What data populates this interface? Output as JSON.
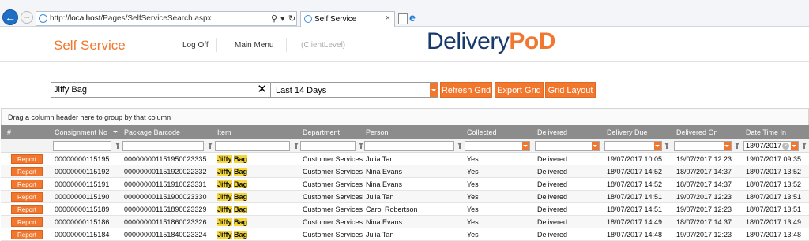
{
  "browser": {
    "url_prefix": "http://",
    "url_host": "localhost",
    "url_path": "/Pages/SelfServiceSearch.aspx",
    "tab_title": "Self Service"
  },
  "header": {
    "app_title": "Self Service",
    "nav": [
      "Log Off",
      "Main Menu",
      "(ClientLevel)"
    ],
    "logo_part1": "Delivery",
    "logo_part2": "PoD"
  },
  "toolbar": {
    "search_value": "Jiffy Bag",
    "period": "Last 14 Days",
    "buttons": [
      "Refresh Grid",
      "Export Grid",
      "Grid Layout"
    ]
  },
  "grid": {
    "group_hint": "Drag a column header here to group by that column",
    "columns": [
      "#",
      "Consignment No",
      "Package Barcode",
      "Item",
      "Department",
      "Person",
      "Collected",
      "Delivered",
      "Delivery Due",
      "Delivered On",
      "Date Time In"
    ],
    "date_filter": "13/07/2017",
    "report_label": "Report",
    "highlight": [
      "Jiffy",
      "Bag"
    ],
    "rows": [
      {
        "consignment": "00000000115195",
        "barcode": "000000001151950023335",
        "department": "Customer Services",
        "person": "Julia Tan",
        "collected": "Yes",
        "delivered": "Delivered",
        "due": "19/07/2017 10:05",
        "delivered_on": "19/07/2017 12:23",
        "time_in": "19/07/2017 09:35"
      },
      {
        "consignment": "00000000115192",
        "barcode": "000000001151920022332",
        "department": "Customer Services",
        "person": "Nina Evans",
        "collected": "Yes",
        "delivered": "Delivered",
        "due": "18/07/2017 14:52",
        "delivered_on": "18/07/2017 14:37",
        "time_in": "18/07/2017 13:52"
      },
      {
        "consignment": "00000000115191",
        "barcode": "000000001151910023331",
        "department": "Customer Services",
        "person": "Nina Evans",
        "collected": "Yes",
        "delivered": "Delivered",
        "due": "18/07/2017 14:52",
        "delivered_on": "18/07/2017 14:37",
        "time_in": "18/07/2017 13:52"
      },
      {
        "consignment": "00000000115190",
        "barcode": "000000001151900023330",
        "department": "Customer Services",
        "person": "Julia Tan",
        "collected": "Yes",
        "delivered": "Delivered",
        "due": "18/07/2017 14:51",
        "delivered_on": "19/07/2017 12:23",
        "time_in": "18/07/2017 13:51"
      },
      {
        "consignment": "00000000115189",
        "barcode": "000000001151890023329",
        "department": "Customer Services",
        "person": "Carol Robertson",
        "collected": "Yes",
        "delivered": "Delivered",
        "due": "18/07/2017 14:51",
        "delivered_on": "19/07/2017 12:23",
        "time_in": "18/07/2017 13:51"
      },
      {
        "consignment": "00000000115186",
        "barcode": "000000001151860023326",
        "department": "Customer Services",
        "person": "Nina Evans",
        "collected": "Yes",
        "delivered": "Delivered",
        "due": "18/07/2017 14:49",
        "delivered_on": "18/07/2017 14:37",
        "time_in": "18/07/2017 13:49"
      },
      {
        "consignment": "00000000115184",
        "barcode": "000000001151840023324",
        "department": "Customer Services",
        "person": "Julia Tan",
        "collected": "Yes",
        "delivered": "Delivered",
        "due": "18/07/2017 14:48",
        "delivered_on": "19/07/2017 12:23",
        "time_in": "18/07/2017 13:48"
      }
    ]
  }
}
